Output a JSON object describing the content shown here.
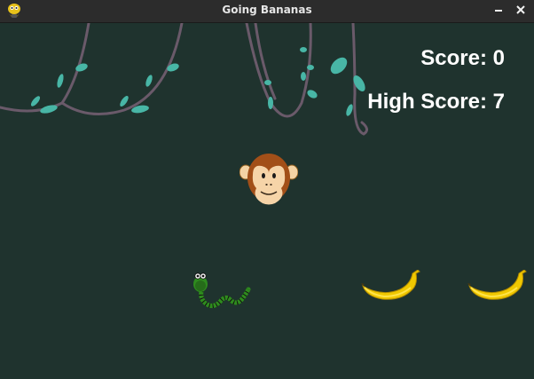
{
  "window": {
    "title": "Going Bananas",
    "app_icon": "pygame-snake-icon",
    "controls": [
      "minimize-icon",
      "close-icon"
    ]
  },
  "hud": {
    "score_label": "Score: 0",
    "high_score_label": "High Score: 7",
    "text_color": "#ffffff"
  },
  "scene": {
    "background_color": "#1f332e",
    "sprites": [
      "jungle-vines",
      "monkey",
      "snake",
      "banana",
      "banana"
    ]
  }
}
